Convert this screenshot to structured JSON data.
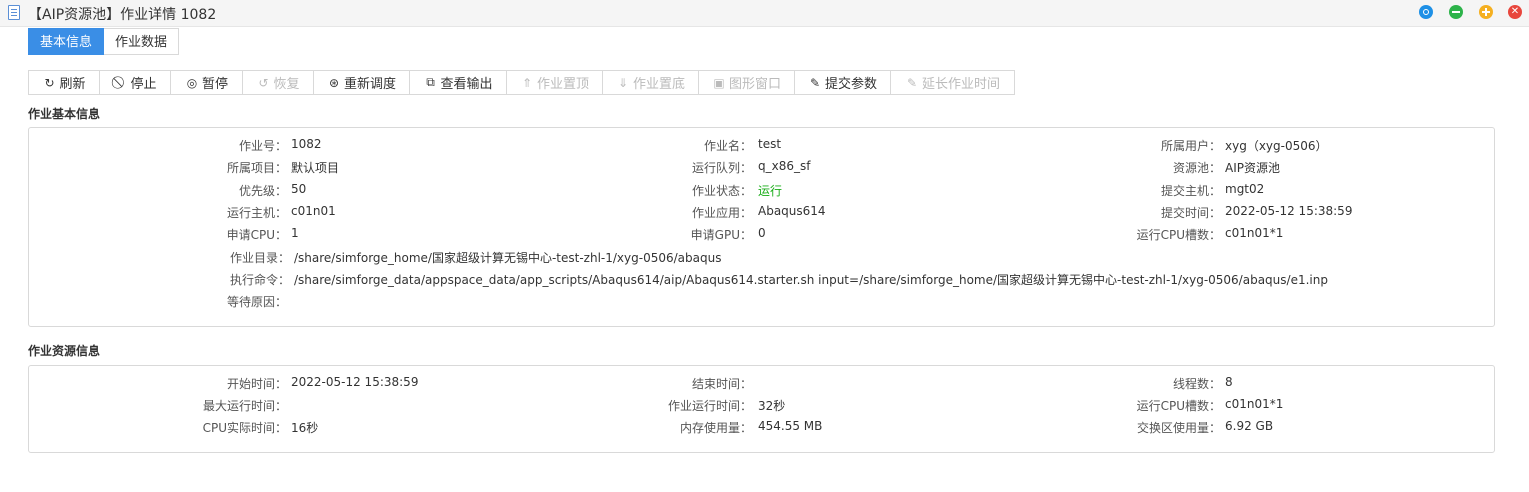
{
  "window": {
    "title": "【AIP资源池】作业详情 1082",
    "controls": [
      "target-icon",
      "minimize-icon",
      "maximize-icon",
      "close-icon"
    ],
    "control_colors": {
      "target": "#1e90e6",
      "minimize": "#2db34a",
      "maximize": "#f5b021",
      "close": "#e8463c"
    }
  },
  "tabs": [
    {
      "label": "基本信息",
      "active": true
    },
    {
      "label": "作业数据",
      "active": false
    }
  ],
  "toolbar": [
    {
      "label": "刷新",
      "icon": "refresh-icon",
      "enabled": true
    },
    {
      "label": "停止",
      "icon": "stop-icon",
      "enabled": true
    },
    {
      "label": "暂停",
      "icon": "pause-icon",
      "enabled": true
    },
    {
      "label": "恢复",
      "icon": "resume-icon",
      "enabled": false
    },
    {
      "label": "重新调度",
      "icon": "reschedule-icon",
      "enabled": true
    },
    {
      "label": "查看输出",
      "icon": "view-output-icon",
      "enabled": true
    },
    {
      "label": "作业置顶",
      "icon": "pin-top-icon",
      "enabled": false
    },
    {
      "label": "作业置底",
      "icon": "pin-bottom-icon",
      "enabled": false
    },
    {
      "label": "图形窗口",
      "icon": "graphic-window-icon",
      "enabled": false
    },
    {
      "label": "提交参数",
      "icon": "edit-params-icon",
      "enabled": true
    },
    {
      "label": "延长作业时间",
      "icon": "extend-time-icon",
      "enabled": false
    }
  ],
  "basic_info": {
    "title": "作业基本信息",
    "rows": [
      [
        {
          "label": "作业号：",
          "value": "1082"
        },
        {
          "label": "作业名：",
          "value": "test"
        },
        {
          "label": "所属用户：",
          "value": "xyg（xyg-0506）"
        }
      ],
      [
        {
          "label": "所属项目：",
          "value": "默认项目"
        },
        {
          "label": "运行队列：",
          "value": "q_x86_sf"
        },
        {
          "label": "资源池：",
          "value": "AIP资源池"
        }
      ],
      [
        {
          "label": "优先级：",
          "value": "50"
        },
        {
          "label": "作业状态：",
          "value": "运行",
          "status_color": "#1aad19"
        },
        {
          "label": "提交主机：",
          "value": "mgt02"
        }
      ],
      [
        {
          "label": "运行主机：",
          "value": "c01n01"
        },
        {
          "label": "作业应用：",
          "value": "Abaqus614"
        },
        {
          "label": "提交时间：",
          "value": "2022-05-12 15:38:59"
        }
      ],
      [
        {
          "label": "申请CPU：",
          "value": "1"
        },
        {
          "label": "申请GPU：",
          "value": "0"
        },
        {
          "label": "运行CPU槽数：",
          "value": "c01n01*1"
        }
      ]
    ],
    "wide_rows": [
      {
        "label": "作业目录：",
        "value": "/share/simforge_home/国家超级计算无锡中心-test-zhl-1/xyg-0506/abaqus"
      },
      {
        "label": "执行命令：",
        "value": "/share/simforge_data/appspace_data/app_scripts/Abaqus614/aip/Abaqus614.starter.sh input=/share/simforge_home/国家超级计算无锡中心-test-zhl-1/xyg-0506/abaqus/e1.inp"
      },
      {
        "label": "等待原因：",
        "value": ""
      }
    ]
  },
  "resource_info": {
    "title": "作业资源信息",
    "rows": [
      [
        {
          "label": "开始时间：",
          "value": "2022-05-12 15:38:59"
        },
        {
          "label": "结束时间：",
          "value": ""
        },
        {
          "label": "线程数：",
          "value": "8"
        }
      ],
      [
        {
          "label": "最大运行时间：",
          "value": ""
        },
        {
          "label": "作业运行时间：",
          "value": "32秒"
        },
        {
          "label": "运行CPU槽数：",
          "value": "c01n01*1"
        }
      ],
      [
        {
          "label": "CPU实际时间：",
          "value": "16秒"
        },
        {
          "label": "内存使用量：",
          "value": "454.55 MB"
        },
        {
          "label": "交换区使用量：",
          "value": "6.92 GB"
        }
      ]
    ]
  }
}
